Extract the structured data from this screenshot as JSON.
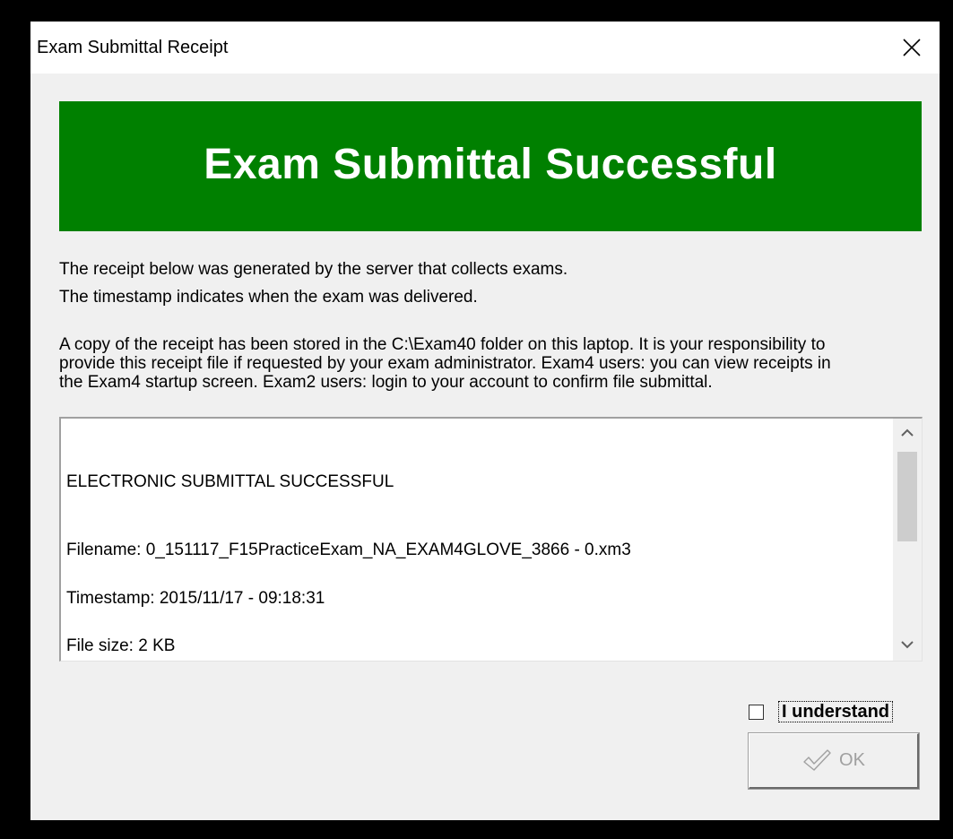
{
  "window": {
    "title": "Exam Submittal Receipt"
  },
  "banner": {
    "text": "Exam Submittal Successful",
    "color": "#008000"
  },
  "info": {
    "line1": "The receipt below was generated by the server that collects exams.",
    "line2": "The timestamp indicates when the exam was delivered."
  },
  "notice": {
    "lines": [
      "A copy of the receipt has been stored in the C:\\Exam40 folder on this laptop. It is your responsibility to",
      "provide this receipt file if requested by your exam administrator. Exam4 users: you can view receipts in",
      "the Exam4 startup screen. Exam2 users: login to your account to confirm file submittal."
    ]
  },
  "receipt": {
    "status": "ELECTRONIC SUBMITTAL SUCCESSFUL",
    "filename": "Filename: 0_151117_F15PracticeExam_NA_EXAM4GLOVE_3866 - 0.xm3",
    "timestamp": "Timestamp: 2015/11/17 - 09:18:31",
    "filesize": "File size: 2 KB"
  },
  "controls": {
    "understand_label": "I understand",
    "understand_checked": false,
    "ok_label": "OK",
    "ok_enabled": false
  },
  "icons": {
    "close": "close-icon",
    "scroll_up": "chevron-up-icon",
    "scroll_down": "chevron-down-icon",
    "ok": "checkmark-icon"
  }
}
